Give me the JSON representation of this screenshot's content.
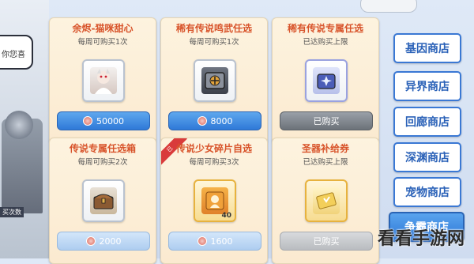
{
  "left": {
    "speech_text": "你您喜",
    "robot_label": "买次数"
  },
  "cards": [
    {
      "title": "余烬-猫咪甜心",
      "limit": "每周可购买1次",
      "button": "50000",
      "button_style": "blue",
      "item_icon": "character-portrait-icon"
    },
    {
      "title": "稀有传说鸣武任选",
      "limit": "每周可购买1次",
      "button": "8000",
      "button_style": "blue",
      "item_icon": "weapon-crate-icon"
    },
    {
      "title": "稀有传说专属任选",
      "limit": "已达购买上限",
      "button": "已购买",
      "button_style": "gray",
      "item_icon": "exclusive-gear-box-icon"
    },
    {
      "title": "传说专属任选箱",
      "limit": "每周可购买2次",
      "button": "2000",
      "button_style": "light",
      "item_icon": "treasure-chest-icon"
    },
    {
      "title": "传说少女碎片自选",
      "limit": "每周可购买3次",
      "button": "1600",
      "button_style": "light",
      "item_icon": "fragment-box-icon",
      "quantity": "40",
      "ribbon": "已"
    },
    {
      "title": "圣器补给券",
      "limit": "已达购买上限",
      "button": "已购买",
      "button_style": "lightgray",
      "item_icon": "supply-ticket-icon"
    }
  ],
  "sidebar": {
    "items": [
      {
        "label": "基因商店"
      },
      {
        "label": "异界商店"
      },
      {
        "label": "回廊商店"
      },
      {
        "label": "深渊商店"
      },
      {
        "label": "宠物商店"
      },
      {
        "label": "争霸商店",
        "active": true
      }
    ]
  },
  "watermark": "看看手游网",
  "colors": {
    "accent_blue": "#2f79d8",
    "title_red": "#d8542b",
    "card_bg": "#fdf3df"
  }
}
